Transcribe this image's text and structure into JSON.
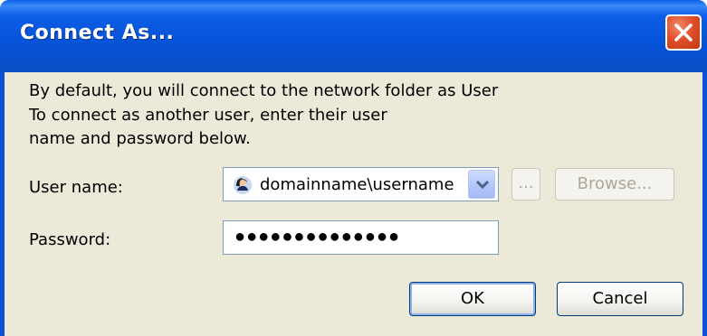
{
  "window": {
    "title": "Connect As...",
    "accent_color": "#0a52d8",
    "client_color": "#ece9d8"
  },
  "message": {
    "line1": "By default, you will connect to the network folder as User",
    "line2": "To connect as another user, enter their user",
    "line3": "name and password below."
  },
  "username": {
    "label": "User name:",
    "value": "domainname\\username",
    "icon": "user-icon",
    "ellipsis_label": "...",
    "browse_label": "Browse..."
  },
  "password": {
    "label": "Password:",
    "value": "●●●●●●●●●●●●●●"
  },
  "buttons": {
    "ok": "OK",
    "cancel": "Cancel"
  }
}
